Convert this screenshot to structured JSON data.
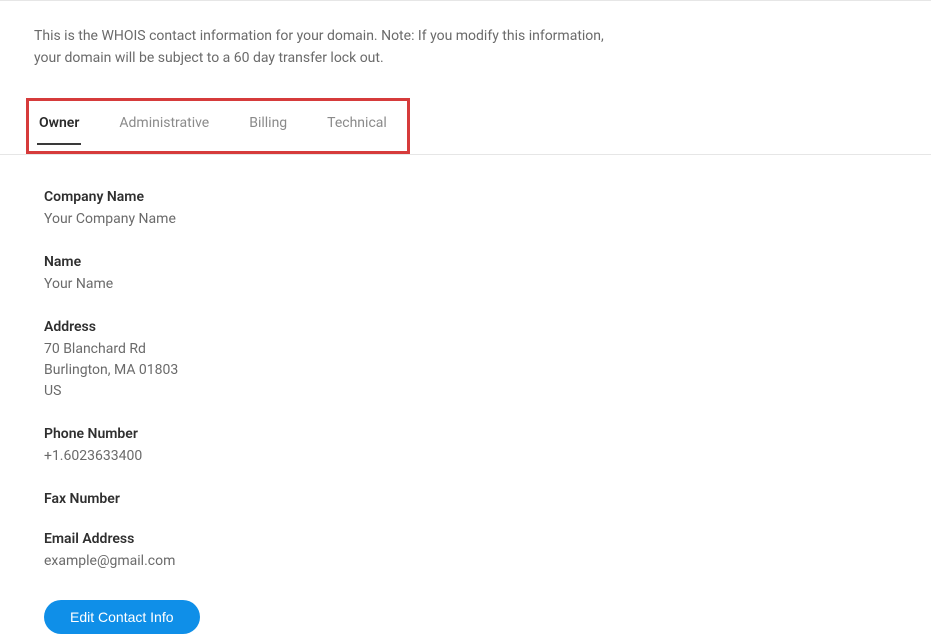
{
  "description": {
    "line1": "This is the WHOIS contact information for your domain. Note: If you modify this information,",
    "line2": "your domain will be subject to a 60 day transfer lock out."
  },
  "tabs": {
    "owner": "Owner",
    "administrative": "Administrative",
    "billing": "Billing",
    "technical": "Technical"
  },
  "fields": {
    "company_name": {
      "label": "Company Name",
      "value": "Your Company Name"
    },
    "name": {
      "label": "Name",
      "value": "Your Name"
    },
    "address": {
      "label": "Address",
      "line1": "70 Blanchard Rd",
      "line2": "Burlington, MA 01803",
      "line3": "US"
    },
    "phone": {
      "label": "Phone Number",
      "value": "+1.6023633400"
    },
    "fax": {
      "label": "Fax Number",
      "value": ""
    },
    "email": {
      "label": "Email Address",
      "value": "example@gmail.com"
    }
  },
  "buttons": {
    "edit": "Edit Contact Info"
  }
}
